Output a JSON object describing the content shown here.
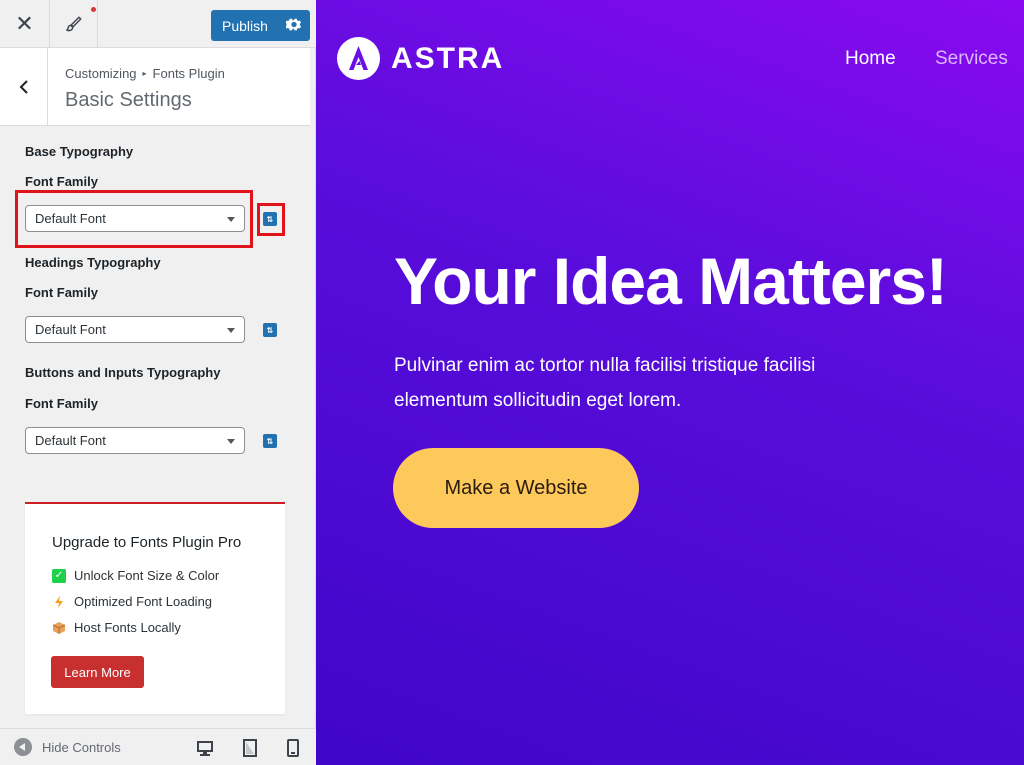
{
  "topbar": {
    "publish_label": "Publish"
  },
  "section": {
    "breadcrumb_root": "Customizing",
    "breadcrumb_child": "Fonts Plugin",
    "title": "Basic Settings"
  },
  "groups": [
    {
      "title": "Base Typography",
      "field_label": "Font Family",
      "select_value": "Default Font"
    },
    {
      "title": "Headings Typography",
      "field_label": "Font Family",
      "select_value": "Default Font"
    },
    {
      "title": "Buttons and Inputs Typography",
      "field_label": "Font Family",
      "select_value": "Default Font"
    }
  ],
  "upgrade": {
    "title": "Upgrade to Fonts Plugin Pro",
    "features": [
      {
        "icon": "check-icon",
        "label": "Unlock Font Size & Color"
      },
      {
        "icon": "lightning-icon",
        "label": "Optimized Font Loading"
      },
      {
        "icon": "box-icon",
        "label": "Host Fonts Locally"
      }
    ],
    "button_label": "Learn More"
  },
  "footer": {
    "hide_label": "Hide Controls"
  },
  "preview": {
    "logo_text": "ASTRA",
    "nav": [
      {
        "label": "Home",
        "color": "#ffffff"
      },
      {
        "label": "Services",
        "color": "#d9b8ff"
      }
    ],
    "hero_title": "Your Idea Matters!",
    "hero_text": "Pulvinar enim ac tortor nulla facilisi tristique facilisi elementum sollicitudin eget lorem.",
    "cta_label": "Make a Website"
  },
  "colors": {
    "accent": "#2271b1",
    "highlight": "#e0131b",
    "cta": "#fcc95a",
    "learn_more": "#c82f2f"
  }
}
